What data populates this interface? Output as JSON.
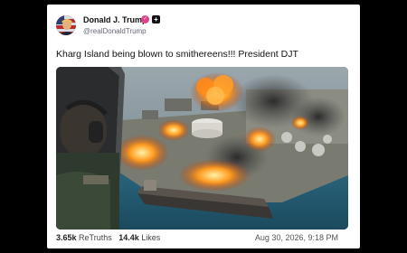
{
  "post": {
    "author_name": "Donald J. Trump",
    "handle": "@realDonaldTrump",
    "text": "Kharg Island being blown to smithereens!!! President DJT",
    "retruths_count": "3.65k",
    "retruths_label": "ReTruths",
    "likes_count": "14.4k",
    "likes_label": "Likes",
    "timestamp": "Aug 30, 2026, 9:18 PM"
  },
  "icons": {
    "verified": "verified-check-icon",
    "badge": "plus-badge-icon"
  },
  "colors": {
    "verified_badge": "#e0408a",
    "background": "#000000",
    "card": "#ffffff"
  }
}
